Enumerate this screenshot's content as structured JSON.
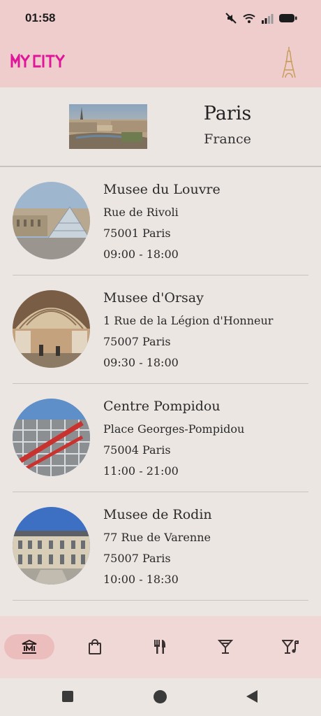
{
  "status": {
    "time": "01:58"
  },
  "app": {
    "logo_text": "MY CITY"
  },
  "city": {
    "name": "Paris",
    "country": "France"
  },
  "places": [
    {
      "name": "Musee du Louvre",
      "street": "Rue de Rivoli",
      "city": "75001 Paris",
      "hours": "09:00 - 18:00"
    },
    {
      "name": "Musee d'Orsay",
      "street": "1 Rue de la Légion d'Honneur",
      "city": "75007 Paris",
      "hours": "09:30 - 18:00"
    },
    {
      "name": "Centre Pompidou",
      "street": "Place Georges-Pompidou",
      "city": "75004 Paris",
      "hours": "11:00 - 21:00"
    },
    {
      "name": "Musee de Rodin",
      "street": "77 Rue de Varenne",
      "city": "75007 Paris",
      "hours": "10:00 - 18:30"
    }
  ],
  "nav": [
    "museum-icon",
    "shopping-bag-icon",
    "restaurant-icon",
    "cocktail-icon",
    "nightlife-icon"
  ],
  "colors": {
    "accent": "#e0169a",
    "appbar": "#f0cdcd",
    "background": "#ece6e3",
    "nav_active": "#ebbebd"
  }
}
